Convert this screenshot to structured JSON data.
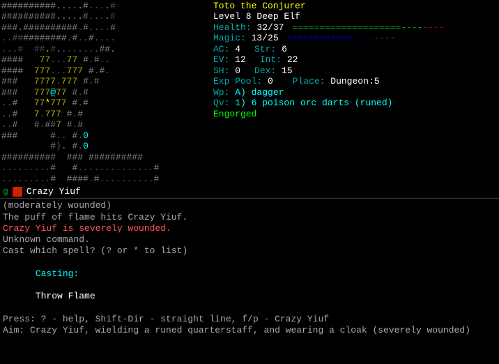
{
  "character": {
    "name": "Toto the Conjurer",
    "level": "Level 8 Deep Elf",
    "health_label": "Health:",
    "health_current": "32",
    "health_max": "37",
    "magic_label": "Magic:",
    "magic_current": "13",
    "magic_max": "25",
    "ac_label": "AC:",
    "ac_value": "4",
    "str_label": "Str:",
    "str_value": "6",
    "ev_label": "EV:",
    "ev_value": "12",
    "int_label": "Int:",
    "int_value": "22",
    "sh_label": "SH:",
    "sh_value": "0",
    "dex_label": "Dex:",
    "dex_value": "15",
    "exp_label": "Exp Pool:",
    "exp_value": "0",
    "place_label": "Place:",
    "place_value": "Dungeon:5",
    "wp_label": "Wp:",
    "wp_value": "A) dagger",
    "qv_label": "Qv:",
    "qv_value": "1) 6 poison orc darts (runed)",
    "status": "Engorged",
    "hp_bar": "====================----",
    "mp_bar": "============----"
  },
  "monster": {
    "label": "g",
    "name": "Crazy Yiuf",
    "color": "#cc2200"
  },
  "messages": [
    {
      "text": "(moderately wounded)",
      "class": "msg-normal"
    },
    {
      "text": "The puff of flame hits Crazy Yiuf.",
      "class": "msg-normal"
    },
    {
      "text": "Crazy Yiuf is severely wounded.",
      "class": "msg-red"
    },
    {
      "text": "Unknown command.",
      "class": "msg-normal"
    },
    {
      "text": "Cast which spell? (? or * to list)",
      "class": "msg-normal"
    },
    {
      "text": "Casting:",
      "class": "casting-label",
      "value": "Throw Flame",
      "value_class": "casting-value"
    },
    {
      "text": "Press: ? - help, Shift-Dir - straight line, f/p - Crazy Yiuf",
      "class": "msg-normal"
    },
    {
      "text": "Aim: Crazy Yiuf, wielding a runed quarterstaff, and wearing a cloak (severely wounded)",
      "class": "msg-normal"
    }
  ],
  "map_lines": [
    {
      "text": "##########.....#....",
      "color": "#888"
    },
    {
      "text": "##########.....#....",
      "color": "#888"
    },
    {
      "text": "###.##########.#....",
      "color": "#888"
    },
    {
      "text": "..##########.#..#....",
      "color": "#888"
    },
    {
      "text": "...#  ##.#.......##.",
      "color": "#888"
    },
    {
      "text": "####   77...77 #.#..",
      "color": "#888"
    },
    {
      "text": "####  777...777 #.#.",
      "color": "#888"
    },
    {
      "text": "###   7777.777 #.#",
      "color": "#888"
    },
    {
      "text": "###   777@77 #.#",
      "color": "#888"
    },
    {
      "text": "..#   77*777 #.#",
      "color": "#888"
    },
    {
      "text": "..#   7.777 #.#",
      "color": "#888"
    },
    {
      "text": "..#   #.##7 #.#",
      "color": "#888"
    },
    {
      "text": "###      #.. #.0",
      "color": "#888"
    },
    {
      "text": "         #). #.0",
      "color": "#888"
    },
    {
      "text": "##########  ### ##########",
      "color": "#888"
    },
    {
      "text": ".........#   #..............#",
      "color": "#888"
    },
    {
      "text": ".........#  ####.#..........#",
      "color": "#888"
    }
  ]
}
